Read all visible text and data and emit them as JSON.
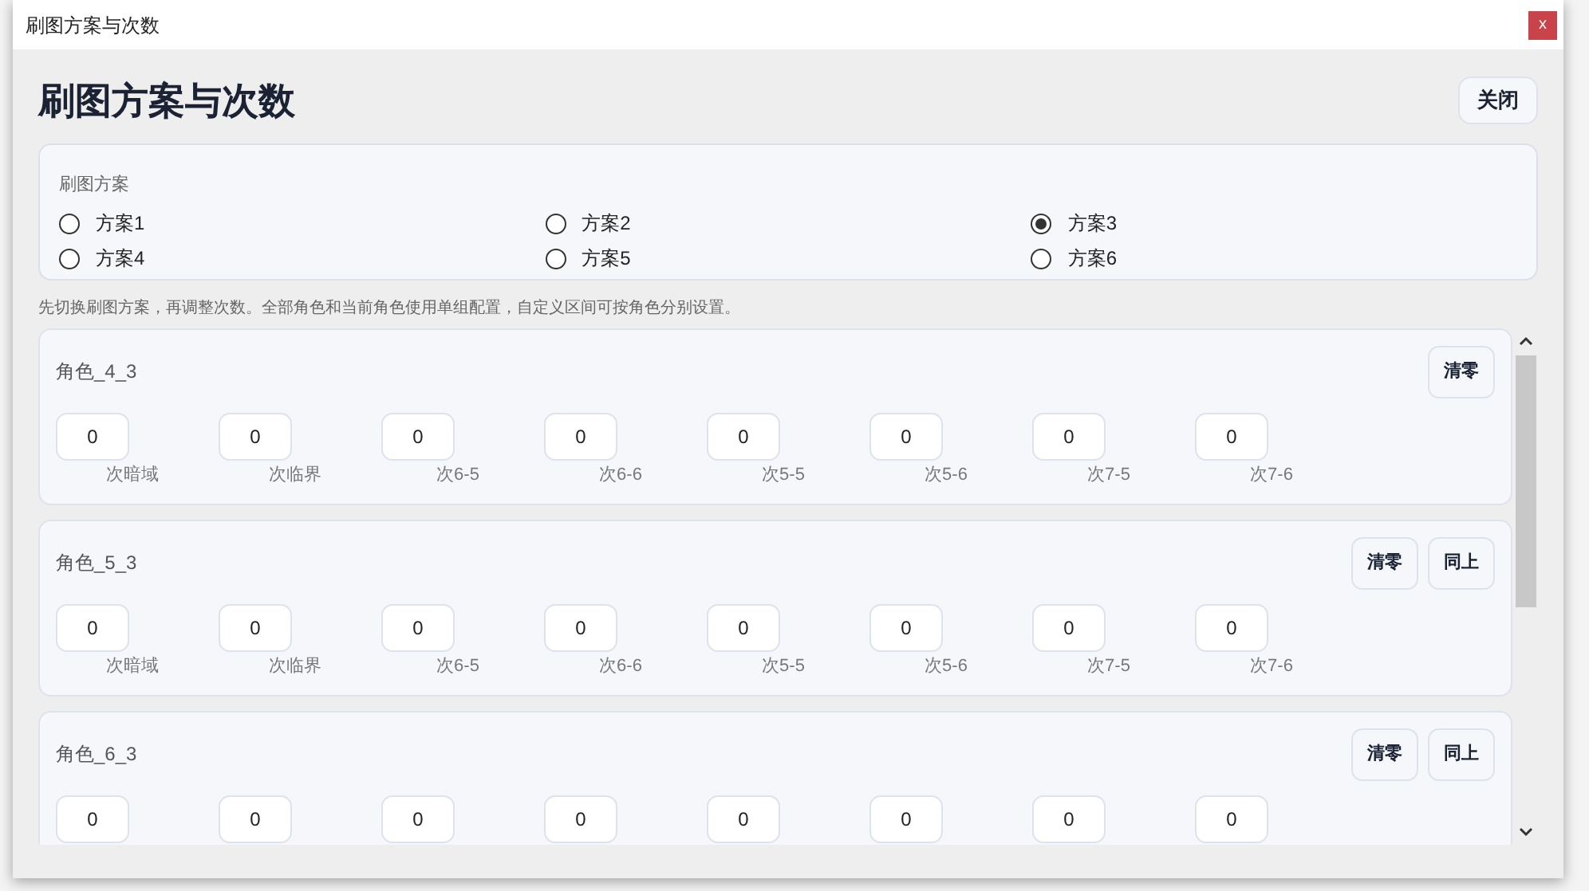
{
  "window": {
    "title": "刷图方案与次数",
    "close": "x"
  },
  "heading": "刷图方案与次数",
  "close_button": "关闭",
  "plan_group": {
    "label": "刷图方案",
    "options": [
      {
        "label": "方案1",
        "selected": false
      },
      {
        "label": "方案2",
        "selected": false
      },
      {
        "label": "方案3",
        "selected": true
      },
      {
        "label": "方案4",
        "selected": false
      },
      {
        "label": "方案5",
        "selected": false
      },
      {
        "label": "方案6",
        "selected": false
      }
    ]
  },
  "note": "先切换刷图方案，再调整次数。全部角色和当前角色使用单组配置，自定义区间可按角色分别设置。",
  "roles": [
    {
      "name": "角色_4_3",
      "buttons": [
        "清零"
      ],
      "fields": [
        {
          "value": "0",
          "label": "次暗域"
        },
        {
          "value": "0",
          "label": "次临界"
        },
        {
          "value": "0",
          "label": "次6-5"
        },
        {
          "value": "0",
          "label": "次6-6"
        },
        {
          "value": "0",
          "label": "次5-5"
        },
        {
          "value": "0",
          "label": "次5-6"
        },
        {
          "value": "0",
          "label": "次7-5"
        },
        {
          "value": "0",
          "label": "次7-6"
        }
      ]
    },
    {
      "name": "角色_5_3",
      "buttons": [
        "清零",
        "同上"
      ],
      "fields": [
        {
          "value": "0",
          "label": "次暗域"
        },
        {
          "value": "0",
          "label": "次临界"
        },
        {
          "value": "0",
          "label": "次6-5"
        },
        {
          "value": "0",
          "label": "次6-6"
        },
        {
          "value": "0",
          "label": "次5-5"
        },
        {
          "value": "0",
          "label": "次5-6"
        },
        {
          "value": "0",
          "label": "次7-5"
        },
        {
          "value": "0",
          "label": "次7-6"
        }
      ]
    },
    {
      "name": "角色_6_3",
      "buttons": [
        "清零",
        "同上"
      ],
      "fields": [
        {
          "value": "0"
        },
        {
          "value": "0"
        },
        {
          "value": "0"
        },
        {
          "value": "0"
        },
        {
          "value": "0"
        },
        {
          "value": "0"
        },
        {
          "value": "0"
        },
        {
          "value": "0"
        }
      ]
    }
  ]
}
